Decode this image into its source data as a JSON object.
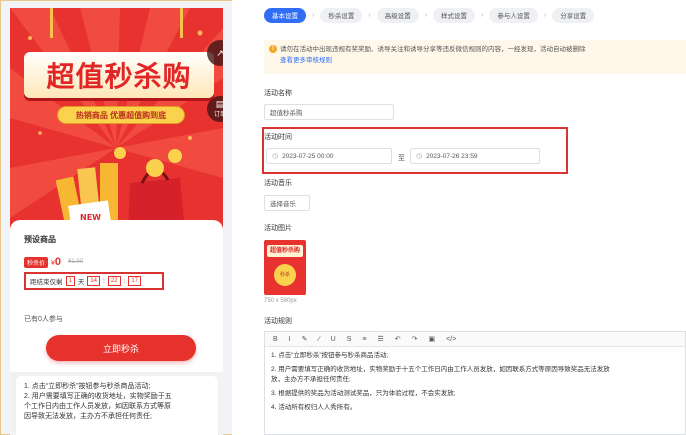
{
  "preview": {
    "poster_title": "超值秒杀购",
    "poster_subtitle": "热销商品 优惠超值购到底",
    "poster_tag": "NEW",
    "side_buttons": [
      {
        "label": "",
        "icon": "share-icon"
      },
      {
        "label": "订单",
        "icon": "order-icon"
      }
    ],
    "goods_title": "预设商品",
    "price_badge": "秒杀价",
    "price_currency": "¥",
    "price": "0",
    "old_price": "¥1.00",
    "countdown": {
      "prefix": "距结束仅剩",
      "days": "1",
      "day_unit": "天",
      "hours": "14",
      "minutes": "22",
      "seconds": "17",
      "separator": ":"
    },
    "joined_text": "已有0人参与",
    "join_button": "立即秒杀",
    "rules": [
      "1. 点击“立即秒杀”按钮参与秒杀商品活动;",
      "2. 用户需要填写正确的收货地址，实物奖励于五",
      "个工作日内由工作人员发放，如因联系方式等原",
      "因导致无法发放，主办方不承担任何责任;"
    ]
  },
  "editor": {
    "steps": [
      "基本设置",
      "秒杀设置",
      "高级设置",
      "样式设置",
      "参与人设置",
      "分享设置"
    ],
    "active_step": 0,
    "notice_text": "请勿在活动中出现违规有奖奖励、诱导关注和诱导分享等违反微信规则的内容，一经发现，活动自动被删除",
    "notice_link": "查看更多审核规则",
    "fields": {
      "activity_name_label": "活动名称",
      "activity_name_value": "超值秒杀购",
      "time_label": "活动时间",
      "start_time": "2023-07-25 00:00",
      "to": "至",
      "end_time": "2023-07-26 23:59",
      "music_label": "活动音乐",
      "music_button": "选择音乐",
      "image_label": "活动图片",
      "image_size_note": "750 x 580px",
      "thumb_title": "超值秒杀购",
      "thumb_badge": "秒杀",
      "rules_label": "活动规则"
    },
    "toolbar": [
      "B",
      "I",
      "✎",
      "∕",
      "U",
      "S",
      "≡",
      "☰",
      "↶",
      "↷",
      "▣",
      "</>"
    ],
    "rules_body": [
      "1. 点击“立即秒杀”按钮参与秒杀商品活动;",
      "2. 用户需要填写正确的收货地址，实物奖励于十五个工作日内由工作人员发放，如因联系方式等原因导致奖品无法发放",
      "放，主办方不承担任何责任;",
      "3. 根据提供的奖品为活动测试奖品，只为体验过程，不会实发放;",
      "4. 活动所有权归人人秀所有。"
    ]
  },
  "colors": {
    "accent": "#2f6ef5",
    "poster_red": "#e8322f",
    "highlight_border": "#d93434",
    "gold": "#fbd24d"
  }
}
